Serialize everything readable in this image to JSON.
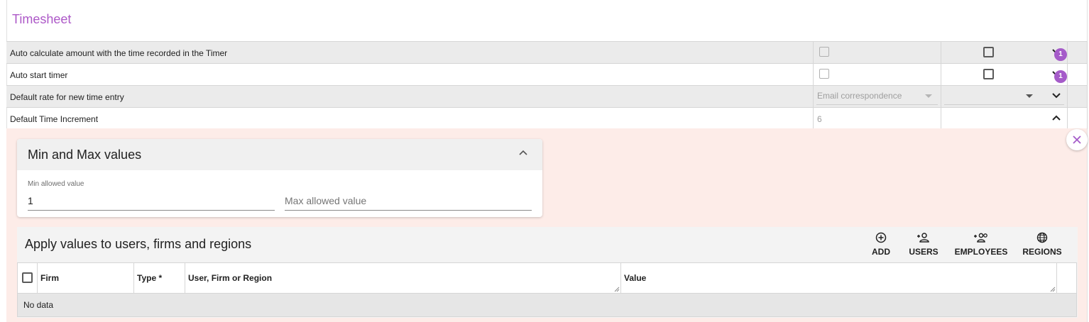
{
  "section": {
    "title": "Timesheet"
  },
  "settings": [
    {
      "label": "Auto calculate amount with the time recorded in the Timer",
      "badge": "1"
    },
    {
      "label": "Auto start timer",
      "badge": "1"
    },
    {
      "label": "Default rate for new time entry",
      "select_value": "Email correspondence"
    },
    {
      "label": "Default Time Increment",
      "number_value": "6"
    }
  ],
  "minmax": {
    "title": "Min and Max values",
    "min_label": "Min allowed value",
    "min_value": "1",
    "max_placeholder": "Max allowed value"
  },
  "apply": {
    "title": "Apply values to users, firms and regions",
    "actions": [
      {
        "label": "ADD",
        "icon": "add-circle-icon"
      },
      {
        "label": "USERS",
        "icon": "person-add-icon"
      },
      {
        "label": "EMPLOYEES",
        "icon": "group-add-icon"
      },
      {
        "label": "REGIONS",
        "icon": "globe-icon"
      }
    ],
    "columns": [
      "Firm",
      "Type *",
      "User, Firm or Region",
      "Value"
    ],
    "empty_text": "No data"
  },
  "colors": {
    "accent": "#ad59c8",
    "badge": "#a55bc9",
    "panel_bg": "#fdece8"
  }
}
